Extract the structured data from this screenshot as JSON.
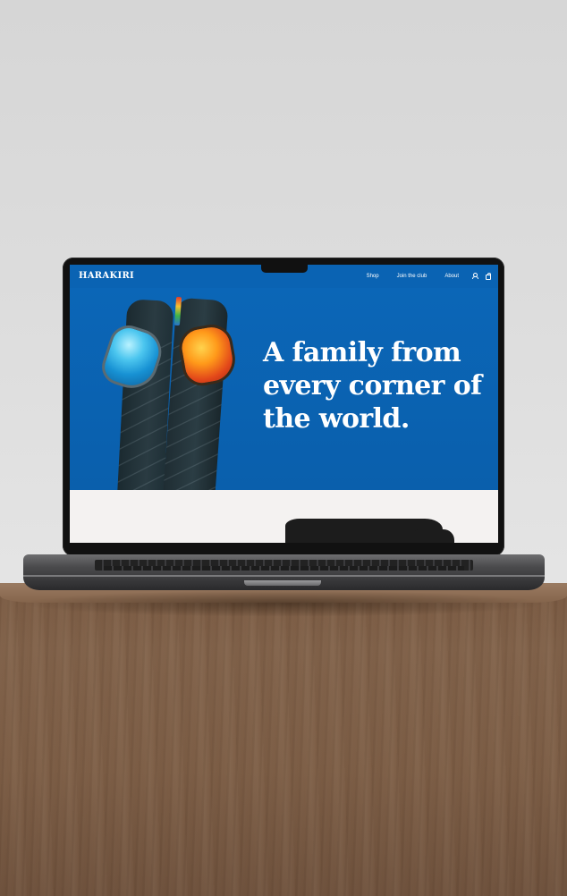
{
  "brand": {
    "name": "HARAKIRI"
  },
  "nav": {
    "links": [
      "Shop",
      "Join the club",
      "About"
    ],
    "icons": [
      "user-icon",
      "bag-icon"
    ]
  },
  "hero": {
    "headline": "A family from every corner of the world."
  },
  "colors": {
    "hero_blue": "#0b66b7",
    "text": "#ffffff",
    "section_bg": "#f4f2f1"
  }
}
